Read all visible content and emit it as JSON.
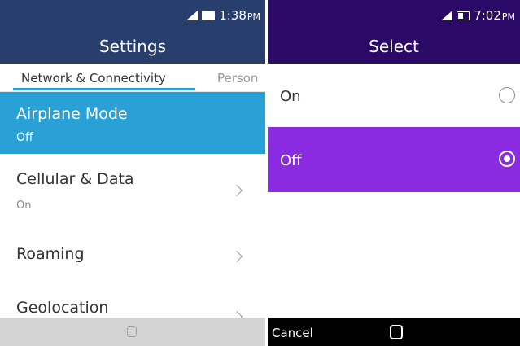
{
  "left_screen": {
    "status": {
      "time": "1:38",
      "suffix": "PM"
    },
    "title": "Settings",
    "tabs": [
      {
        "label": "Network & Connectivity",
        "active": true
      },
      {
        "label": "Person",
        "active": false
      }
    ],
    "items": [
      {
        "title": "Airplane Mode",
        "subtitle": "Off",
        "selected": true
      },
      {
        "title": "Cellular & Data",
        "subtitle": "On"
      },
      {
        "title": "Roaming"
      },
      {
        "title": "Geolocation"
      }
    ],
    "colors": {
      "header": "#283e6d",
      "accent": "#2aa1d6",
      "softkey_bar": "#d4d4d4"
    }
  },
  "right_screen": {
    "status": {
      "time": "7:02",
      "suffix": "PM"
    },
    "title": "Select",
    "options": [
      {
        "label": "On",
        "selected": false
      },
      {
        "label": "Off",
        "selected": true
      }
    ],
    "softkeys": {
      "left": "Cancel"
    },
    "colors": {
      "header": "#2b0a67",
      "selected": "#8a2be2",
      "softkey_bar": "#000000"
    }
  }
}
